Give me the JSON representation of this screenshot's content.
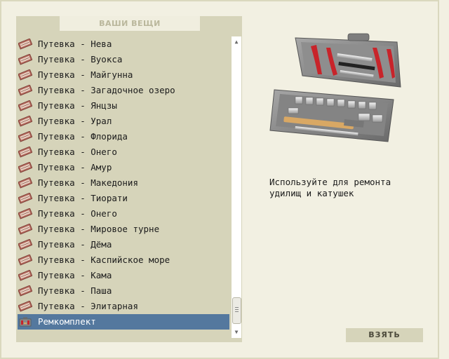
{
  "header": {
    "title": "ВАШИ ВЕЩИ"
  },
  "items": [
    {
      "label": "Путевка - Нева",
      "icon": "ticket-icon"
    },
    {
      "label": "Путевка - Вуокса",
      "icon": "ticket-icon"
    },
    {
      "label": "Путевка - Майгунна",
      "icon": "ticket-icon"
    },
    {
      "label": "Путевка - Загадочное озеро",
      "icon": "ticket-icon"
    },
    {
      "label": "Путевка - Янцзы",
      "icon": "ticket-icon"
    },
    {
      "label": "Путевка - Урал",
      "icon": "ticket-icon"
    },
    {
      "label": "Путевка - Флорида",
      "icon": "ticket-icon"
    },
    {
      "label": "Путевка - Онего",
      "icon": "ticket-icon"
    },
    {
      "label": "Путевка - Амур",
      "icon": "ticket-icon"
    },
    {
      "label": "Путевка - Македония",
      "icon": "ticket-icon"
    },
    {
      "label": "Путевка - Тиорати",
      "icon": "ticket-icon"
    },
    {
      "label": "Путевка - Онего",
      "icon": "ticket-icon"
    },
    {
      "label": "Путевка - Мировое турне",
      "icon": "ticket-icon"
    },
    {
      "label": "Путевка - Дёма",
      "icon": "ticket-icon"
    },
    {
      "label": "Путевка - Каспийское море",
      "icon": "ticket-icon"
    },
    {
      "label": "Путевка - Кама",
      "icon": "ticket-icon"
    },
    {
      "label": "Путевка - Паша",
      "icon": "ticket-icon"
    },
    {
      "label": "Путевка - Элитарная",
      "icon": "ticket-icon"
    },
    {
      "label": "Ремкомплект",
      "icon": "repair-kit-icon",
      "selected": true
    }
  ],
  "detail": {
    "image": "toolbox-image",
    "description": "Используйте для ремонта удилищ и катушек"
  },
  "actions": {
    "take_label": "ВЗЯТЬ"
  },
  "colors": {
    "panel": "#d6d4ba",
    "selected": "#54789e",
    "background": "#f2f0e2"
  }
}
